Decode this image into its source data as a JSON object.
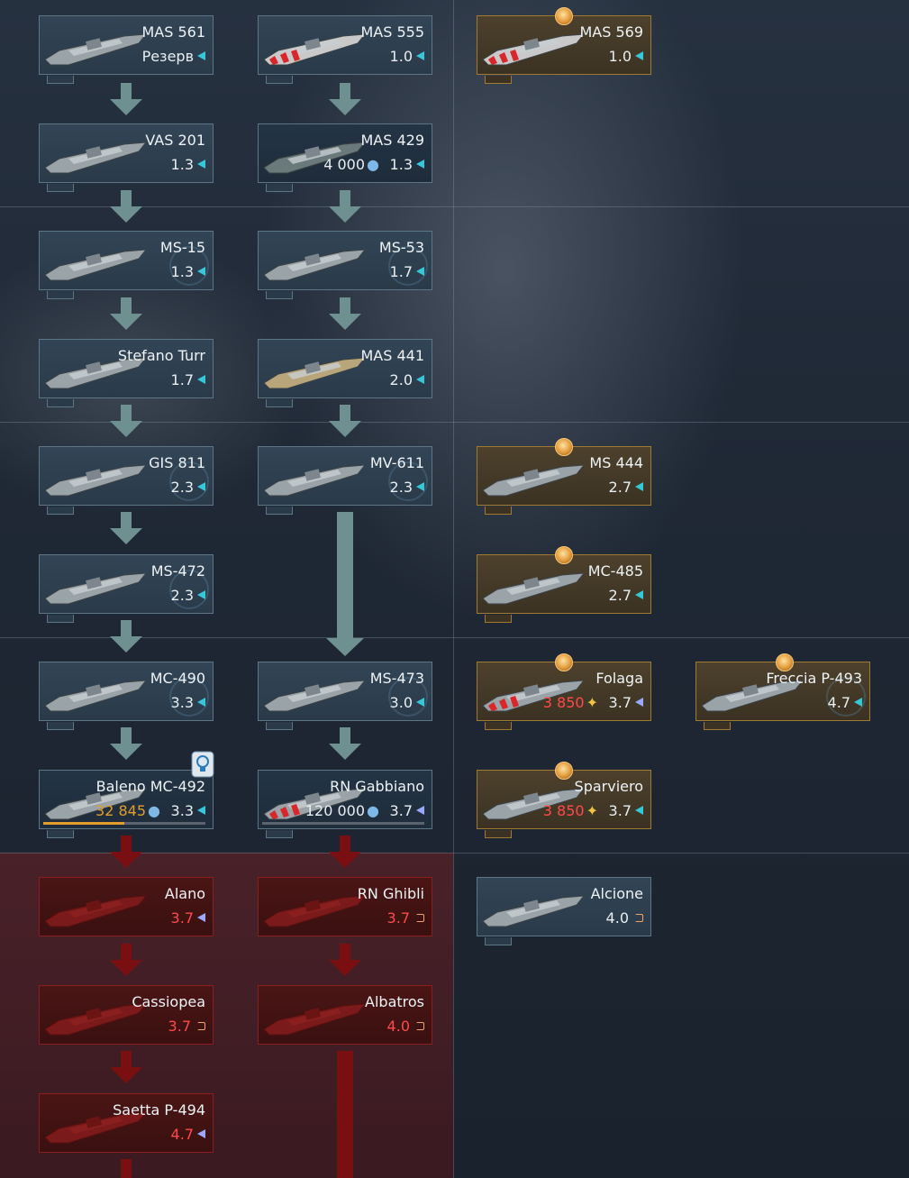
{
  "colors": {
    "accent_cyan": "#36c7d8",
    "premium_gold": "#a07a33",
    "locked_red": "#8a1d1d",
    "research_orange": "#e39d2d",
    "br_red": "#ff4a4a"
  },
  "vehicles": [
    {
      "id": "mas561",
      "name": "MAS 561",
      "br": "Резерв",
      "rank_icon": "cyan-triangle-icon",
      "kind": "normal"
    },
    {
      "id": "mas555",
      "name": "MAS 555",
      "br": "1.0",
      "rank_icon": "cyan-triangle-icon",
      "kind": "normal"
    },
    {
      "id": "mas569",
      "name": "MAS 569",
      "br": "1.0",
      "rank_icon": "cyan-triangle-icon",
      "kind": "premium"
    },
    {
      "id": "vas201",
      "name": "VAS 201",
      "br": "1.3",
      "rank_icon": "cyan-triangle-icon",
      "kind": "normal"
    },
    {
      "id": "mas429",
      "name": "MAS 429",
      "br": "1.3",
      "rank_icon": "cyan-triangle-icon",
      "kind": "research",
      "cost": "4 000"
    },
    {
      "id": "ms15",
      "name": "MS-15",
      "br": "1.3",
      "rank_icon": "cyan-triangle-icon",
      "kind": "normal"
    },
    {
      "id": "ms53",
      "name": "MS-53",
      "br": "1.7",
      "rank_icon": "cyan-triangle-icon",
      "kind": "normal"
    },
    {
      "id": "stefano",
      "name": "Stefano Turr",
      "br": "1.7",
      "rank_icon": "cyan-triangle-icon",
      "kind": "normal"
    },
    {
      "id": "mas441",
      "name": "MAS 441",
      "br": "2.0",
      "rank_icon": "cyan-triangle-icon",
      "kind": "normal"
    },
    {
      "id": "gis811",
      "name": "GIS 811",
      "br": "2.3",
      "rank_icon": "cyan-triangle-icon",
      "kind": "normal"
    },
    {
      "id": "mv611",
      "name": "MV-611",
      "br": "2.3",
      "rank_icon": "cyan-triangle-icon",
      "kind": "normal"
    },
    {
      "id": "ms444",
      "name": "MS 444",
      "br": "2.7",
      "rank_icon": "cyan-triangle-icon",
      "kind": "premium"
    },
    {
      "id": "ms472",
      "name": "MS-472",
      "br": "2.3",
      "rank_icon": "cyan-triangle-icon",
      "kind": "normal"
    },
    {
      "id": "mc485",
      "name": "MC-485",
      "br": "2.7",
      "rank_icon": "cyan-triangle-icon",
      "kind": "premium"
    },
    {
      "id": "mc490",
      "name": "MC-490",
      "br": "3.3",
      "rank_icon": "cyan-triangle-icon",
      "kind": "normal"
    },
    {
      "id": "ms473",
      "name": "MS-473",
      "br": "3.0",
      "rank_icon": "cyan-triangle-icon",
      "kind": "normal"
    },
    {
      "id": "folaga",
      "name": "Folaga",
      "br": "3.7",
      "rank_icon": "blue-triangle-icon",
      "kind": "premium",
      "cost": "3 850",
      "cost_icon": "golden-eagle-icon"
    },
    {
      "id": "freccia",
      "name": "Freccia P-493",
      "br": "4.7",
      "rank_icon": "cyan-triangle-icon",
      "kind": "premium"
    },
    {
      "id": "baleno",
      "name": "Baleno MC-492",
      "br": "3.3",
      "rank_icon": "cyan-triangle-icon",
      "kind": "research",
      "cost": "32 845",
      "progress": 0.5
    },
    {
      "id": "gabbiano",
      "name": "RN Gabbiano",
      "br": "3.7",
      "rank_icon": "blue-triangle-icon",
      "kind": "research",
      "cost": "120 000",
      "progress": 0.0
    },
    {
      "id": "sparviero",
      "name": "Sparviero",
      "br": "3.7",
      "rank_icon": "cyan-triangle-icon",
      "kind": "premium",
      "cost": "3 850",
      "cost_icon": "golden-eagle-icon"
    },
    {
      "id": "alano",
      "name": "Alano",
      "br": "3.7",
      "rank_icon": "blue-triangle-icon",
      "kind": "locked"
    },
    {
      "id": "ghibli",
      "name": "RN Ghibli",
      "br": "3.7",
      "rank_icon": "orange-tag-icon",
      "kind": "locked"
    },
    {
      "id": "alcione",
      "name": "Alcione",
      "br": "4.0",
      "rank_icon": "orange-tag-icon",
      "kind": "normal"
    },
    {
      "id": "cassiopea",
      "name": "Cassiopea",
      "br": "3.7",
      "rank_icon": "orange-tag-icon",
      "kind": "locked"
    },
    {
      "id": "albatros",
      "name": "Albatros",
      "br": "4.0",
      "rank_icon": "orange-tag-icon",
      "kind": "locked"
    },
    {
      "id": "saetta",
      "name": "Saetta P-494",
      "br": "4.7",
      "rank_icon": "blue-triangle-icon",
      "kind": "locked"
    }
  ]
}
